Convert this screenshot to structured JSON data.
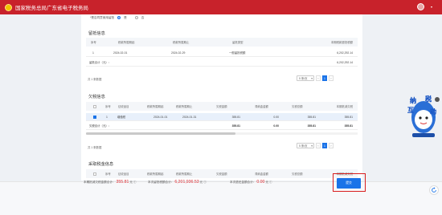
{
  "header": {
    "site_title": "国家税务总局广东省电子税务局",
    "user_text": "",
    "brand_color": "#c8222b"
  },
  "radio_group": {
    "question": "*是否同意使用留抵",
    "options": [
      "是",
      "否"
    ],
    "selected": "是"
  },
  "section1": {
    "title": "留抵信息",
    "columns": [
      "序号",
      "税款所属期起",
      "税款所属期止",
      "留抵类型",
      "本期税款退抵税额"
    ],
    "rows": [
      {
        "index": "1",
        "start": "2024-02-01",
        "end": "2024-02-29",
        "type": "一般留抵税额",
        "amount": "6,202,292.14"
      }
    ],
    "total_label": "留抵合计（元）：",
    "total_amount": "6,202,292.14",
    "count_text": "共 1 条数据",
    "page_size": "5 条/页",
    "current_page": "1"
  },
  "section2": {
    "title": "欠税信息",
    "columns": [
      "序号",
      "征收品目",
      "税款所属期起",
      "税款所属期止",
      "欠税金额",
      "滞纳金金额",
      "欠税总额",
      "本期抵减欠税"
    ],
    "rows": [
      {
        "index": "1",
        "item": "增值税",
        "start": "2024-01-01",
        "end": "2024-01-31",
        "tax": "355.81",
        "late_fee": "0.00",
        "total": "355.81",
        "offset": "355.81"
      }
    ],
    "total_label": "欠税合计（元）：",
    "total_tax": "355.81",
    "total_late_fee": "0.00",
    "total_total": "355.81",
    "total_offset": "355.81",
    "count_text": "共 1 条数据",
    "page_size": "5 条/页",
    "current_page": "1"
  },
  "section3": {
    "title": "采取税金信息",
    "columns": [
      "序号",
      "征收品目",
      "税款所属期起",
      "税款所属期止",
      "欠税金额",
      "滞纳金金额",
      "欠税总额",
      "本期抵减欠税"
    ]
  },
  "footer": {
    "item1_label": "本期抵减欠税金额合计：",
    "item1_value": "355.81",
    "item1_unit": "元",
    "item2_label": "本次留抵税额合计：",
    "item2_value": "6,201,936.53",
    "item2_unit": "元",
    "item3_label": "本次退还金额合计：",
    "item3_value": "0.00",
    "item3_unit": "元",
    "next_label": "提交"
  },
  "mascot": {
    "text": "纳税互动"
  }
}
